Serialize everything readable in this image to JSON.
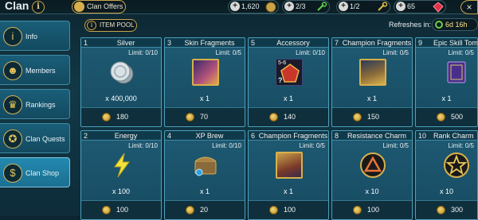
{
  "header": {
    "title": "Clan",
    "info_glyph": "i",
    "clan_offers": "Clan Offers",
    "resources": [
      {
        "value": "1,620",
        "icon": "silver-coin-icon"
      },
      {
        "value": "2/3",
        "icon": "key-icon"
      },
      {
        "value": "1/2",
        "icon": "gold-key-icon"
      },
      {
        "value": "65",
        "icon": "gem-icon"
      }
    ],
    "plus_glyph": "+",
    "close_glyph": "×"
  },
  "sidebar": {
    "items": [
      {
        "label": "Info",
        "icon": "info-icon",
        "glyph": "i"
      },
      {
        "label": "Members",
        "icon": "members-icon",
        "glyph": "☻"
      },
      {
        "label": "Rankings",
        "icon": "trophy-icon",
        "glyph": "♛"
      },
      {
        "label": "Clan Quests",
        "icon": "medal-icon",
        "glyph": "✪"
      },
      {
        "label": "Clan Shop",
        "icon": "money-bag-icon",
        "glyph": "$"
      }
    ]
  },
  "pool": {
    "label": "ITEM POOL",
    "glyph": "i",
    "refresh_label": "Refreshes in:",
    "refresh_time": "6d 16h"
  },
  "colors": {
    "accent_gold": "#d8b04b",
    "panel_blue": "#1e5a73",
    "active_tab": "#2389b0"
  },
  "shop": {
    "cards": [
      {
        "num": "1",
        "name": "Silver",
        "limit": "Limit: 0/10",
        "qty": "x 400,000",
        "price": "180",
        "icon": "silver-coins-icon"
      },
      {
        "num": "3",
        "name": "Skin Fragments",
        "limit": "Limit: 0/5",
        "qty": "x 1",
        "price": "70",
        "icon": "skin-fragment-icon"
      },
      {
        "num": "5",
        "name": "Accessory",
        "limit": "Limit: 0/10",
        "qty": "x 1",
        "price": "140",
        "icon": "accessory-icon",
        "tag": "5-6",
        "mystery": "?"
      },
      {
        "num": "7",
        "name": "Champion Fragments",
        "limit": "Limit: 0/5",
        "qty": "x 1",
        "price": "150",
        "icon": "champion-fragment-icon"
      },
      {
        "num": "9",
        "name": "Epic Skill Tome",
        "limit": "Limit: 0/5",
        "qty": "x 1",
        "price": "500",
        "icon": "skill-tome-icon"
      },
      {
        "num": "2",
        "name": "Energy",
        "limit": "Limit: 0/10",
        "qty": "x 100",
        "price": "100",
        "icon": "energy-bolt-icon"
      },
      {
        "num": "4",
        "name": "XP Brew",
        "limit": "Limit: 0/10",
        "qty": "x 1",
        "price": "20",
        "icon": "xp-brew-chest-icon"
      },
      {
        "num": "6",
        "name": "Champion Fragments",
        "limit": "Limit: 0/5",
        "qty": "x 1",
        "price": "100",
        "icon": "champion-fragment-icon"
      },
      {
        "num": "8",
        "name": "Resistance Charm",
        "limit": "Limit: 0/5",
        "qty": "x 10",
        "price": "100",
        "icon": "resistance-charm-icon"
      },
      {
        "num": "10",
        "name": "Rank Charm",
        "limit": "Limit: 0/5",
        "qty": "x 10",
        "price": "300",
        "icon": "rank-charm-icon"
      }
    ]
  }
}
